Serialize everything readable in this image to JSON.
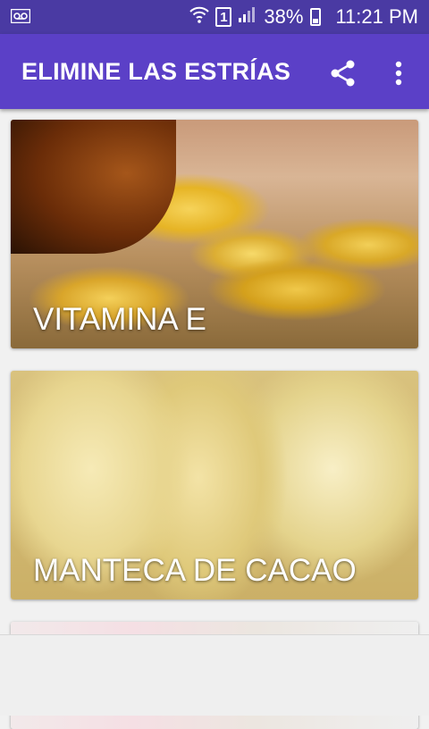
{
  "status_bar": {
    "voicemail_icon": "voicemail-icon",
    "wifi_icon": "wifi-icon",
    "sim_label": "1",
    "signal_icon": "signal-icon",
    "battery_percent": "38%",
    "battery_level": 0.38,
    "time": "11:21 PM"
  },
  "app_bar": {
    "title": "ELIMINE LAS ESTRÍAS",
    "share_icon": "share-icon",
    "more_icon": "more-vert-icon"
  },
  "cards": [
    {
      "label": "VITAMINA E"
    },
    {
      "label": "MANTECA DE CACAO"
    },
    {
      "label": ""
    }
  ],
  "colors": {
    "status_bar": "#4a3aa3",
    "app_bar": "#5b40c7",
    "background": "#f1f1f1"
  }
}
